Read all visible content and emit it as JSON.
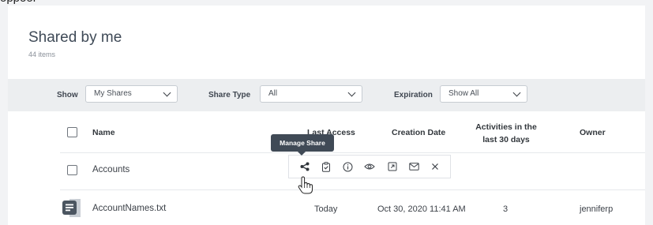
{
  "page": {
    "title": "Shared by me",
    "item_count": "44 items"
  },
  "filters": {
    "show_label": "Show",
    "show_value": "My Shares",
    "share_type_label": "Share Type",
    "share_type_value": "All",
    "expiration_label": "Expiration",
    "expiration_value": "Show All"
  },
  "table": {
    "headers": {
      "name": "Name",
      "last_access": "Last Access",
      "creation_date": "Creation Date",
      "activities_line1": "Activities in the",
      "activities_line2": "last 30 days",
      "owner": "Owner"
    },
    "rows": [
      {
        "name": "Accounts",
        "type": "folder"
      },
      {
        "name": "AccountNames.txt",
        "type": "file",
        "last_access": "Today",
        "creation_date": "Oct 30, 2020 11:41 AM",
        "activities": "3",
        "owner": "jenniferp"
      }
    ]
  },
  "row_toolbar": {
    "icons": [
      "share-icon",
      "clipboard-check-icon",
      "info-icon",
      "eye-icon",
      "external-link-icon",
      "mail-icon",
      "close-icon"
    ],
    "tooltip": "Manage Share"
  },
  "colors": {
    "background": "#f2f3f5",
    "card": "#ffffff",
    "filter_bar": "#eceef0",
    "tooltip": "#404a56"
  }
}
